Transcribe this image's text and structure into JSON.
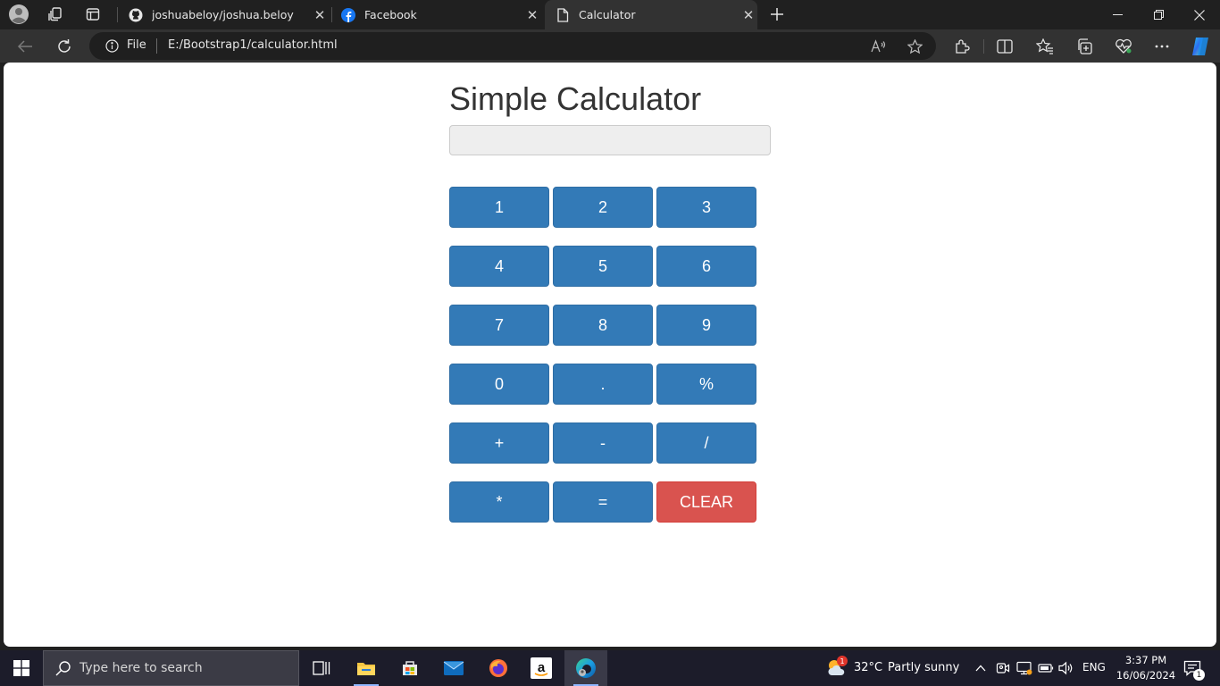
{
  "browser": {
    "tabs": [
      {
        "title": "joshuabeloy/joshua.beloy",
        "favicon": "github-icon",
        "active": false
      },
      {
        "title": "Facebook",
        "favicon": "facebook-icon",
        "active": false
      },
      {
        "title": "Calculator",
        "favicon": "page-icon",
        "active": true
      }
    ],
    "address": {
      "scheme_label": "File",
      "url": "E:/Bootstrap1/calculator.html"
    }
  },
  "page": {
    "title": "Simple Calculator",
    "display_value": "",
    "keys": [
      {
        "label": "1",
        "variant": "primary"
      },
      {
        "label": "2",
        "variant": "primary"
      },
      {
        "label": "3",
        "variant": "primary"
      },
      {
        "label": "4",
        "variant": "primary"
      },
      {
        "label": "5",
        "variant": "primary"
      },
      {
        "label": "6",
        "variant": "primary"
      },
      {
        "label": "7",
        "variant": "primary"
      },
      {
        "label": "8",
        "variant": "primary"
      },
      {
        "label": "9",
        "variant": "primary"
      },
      {
        "label": "0",
        "variant": "primary"
      },
      {
        "label": ".",
        "variant": "primary"
      },
      {
        "label": "%",
        "variant": "primary"
      },
      {
        "label": "+",
        "variant": "primary"
      },
      {
        "label": "-",
        "variant": "primary"
      },
      {
        "label": "/",
        "variant": "primary"
      },
      {
        "label": "*",
        "variant": "primary"
      },
      {
        "label": "=",
        "variant": "primary"
      },
      {
        "label": "CLEAR",
        "variant": "danger"
      }
    ],
    "colors": {
      "primary": "#337ab7",
      "danger": "#d9534f"
    }
  },
  "taskbar": {
    "search_placeholder": "Type here to search",
    "weather_temp": "32°C",
    "weather_desc": "Partly sunny",
    "weather_badge": "1",
    "language": "ENG",
    "time": "3:37 PM",
    "date": "16/06/2024",
    "notification_count": "1"
  }
}
